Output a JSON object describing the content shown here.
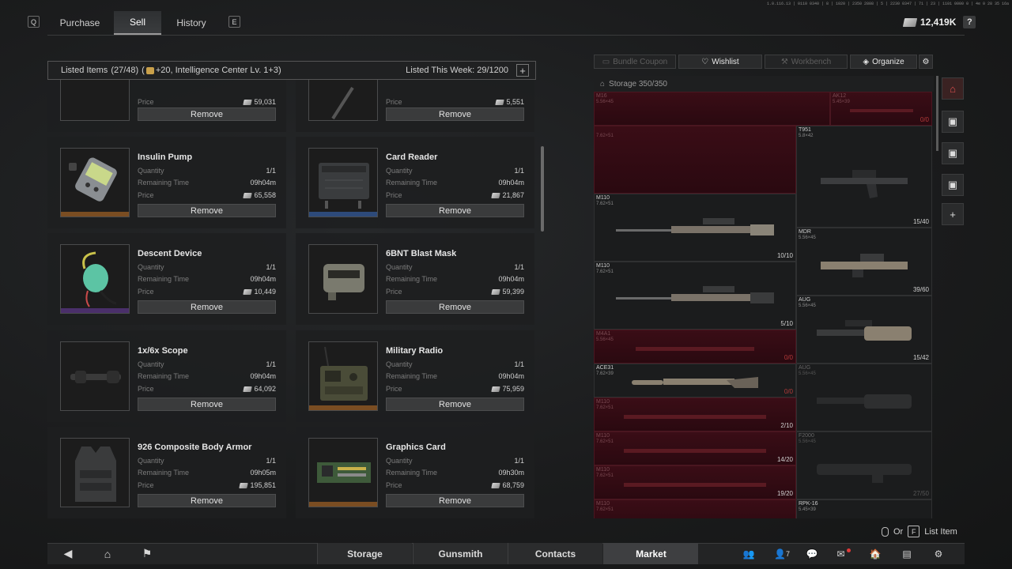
{
  "version_text": "1.0.116.13 | 0110 0340 | 8 | 1020 | 2350 2808 | 5 | 2230 0347 | 71 | 23 | 1101 0000 0 | 4e 0 28 35 16a",
  "top_nav": {
    "left_key": "Q",
    "tabs": [
      {
        "label": "Purchase"
      },
      {
        "label": "Sell",
        "active": true
      },
      {
        "label": "History"
      }
    ],
    "right_key": "E"
  },
  "currency": {
    "amount": "12,419K",
    "help": "?"
  },
  "listed": {
    "label": "Listed Items",
    "count": "(27/48)",
    "bonus": "+20, Intelligence Center Lv. 1+3)",
    "bonus_prefix": "(",
    "week": "Listed This Week: 29/1200",
    "add": "+"
  },
  "labels": {
    "quantity": "Quantity",
    "remaining": "Remaining Time",
    "price": "Price",
    "remove": "Remove"
  },
  "items": [
    {
      "name": "",
      "quantity": "",
      "time": "",
      "price": "59,031",
      "rarity": "#4a4b4c"
    },
    {
      "name": "",
      "quantity": "",
      "time": "",
      "price": "5,551",
      "rarity": "#4a4b4c"
    },
    {
      "name": "Insulin Pump",
      "quantity": "1/1",
      "time": "09h04m",
      "price": "65,558",
      "rarity": "#7a4d22"
    },
    {
      "name": "Card Reader",
      "quantity": "1/1",
      "time": "09h04m",
      "price": "21,867",
      "rarity": "#2d4a7a"
    },
    {
      "name": "Descent Device",
      "quantity": "1/1",
      "time": "09h04m",
      "price": "10,449",
      "rarity": "#4a2f6a"
    },
    {
      "name": "6BNT Blast Mask",
      "quantity": "1/1",
      "time": "09h04m",
      "price": "59,399",
      "rarity": "#4a4b4c"
    },
    {
      "name": "1x/6x Scope",
      "quantity": "1/1",
      "time": "09h04m",
      "price": "64,092",
      "rarity": "#4a4b4c"
    },
    {
      "name": "Military Radio",
      "quantity": "1/1",
      "time": "09h04m",
      "price": "75,959",
      "rarity": "#7a4d22"
    },
    {
      "name": "926 Composite Body Armor",
      "quantity": "1/1",
      "time": "09h05m",
      "price": "195,851",
      "rarity": "#4a4b4c"
    },
    {
      "name": "Graphics Card",
      "quantity": "1/1",
      "time": "09h30m",
      "price": "68,759",
      "rarity": "#7a4d22"
    }
  ],
  "right_tabs": [
    {
      "label": "Bundle Coupon",
      "icon": "coupon-icon"
    },
    {
      "label": "Wishlist",
      "icon": "heart-icon"
    },
    {
      "label": "Workbench",
      "icon": "wrench-icon"
    },
    {
      "label": "Organize",
      "icon": "layers-icon"
    }
  ],
  "storage": {
    "label": "Storage 350/350"
  },
  "guns": [
    {
      "name": "M16",
      "cal": "5.56×45",
      "count": "",
      "red": true
    },
    {
      "name": "AK12",
      "cal": "5.45×39",
      "count": "0/0",
      "red": true
    },
    {
      "name": "",
      "cal": "7.62×51",
      "count": "",
      "red": true
    },
    {
      "name": "T951",
      "cal": "5.8×42",
      "count": "",
      "red": false
    },
    {
      "name": "M110",
      "cal": "7.62×51",
      "count": "10/10",
      "red": false
    },
    {
      "name": "",
      "cal": "",
      "count": "15/40",
      "red": false
    },
    {
      "name": "MDR",
      "cal": "5.56×45",
      "count": "39/60",
      "red": false
    },
    {
      "name": "M110",
      "cal": "7.62×51",
      "count": "5/10",
      "red": false
    },
    {
      "name": "AUG",
      "cal": "5.56×45",
      "count": "15/42",
      "red": false
    },
    {
      "name": "M4A1",
      "cal": "5.56×45",
      "count": "0/0",
      "red": true
    },
    {
      "name": "ACE31",
      "cal": "7.62×39",
      "count": "0/0",
      "red": false
    },
    {
      "name": "AUG",
      "cal": "5.56×45",
      "count": "",
      "red": false
    },
    {
      "name": "M110",
      "cal": "7.62×51",
      "count": "2/10",
      "red": true
    },
    {
      "name": "M110",
      "cal": "7.62×51",
      "count": "14/20",
      "red": true
    },
    {
      "name": "F2000",
      "cal": "5.56×45",
      "count": "27/50",
      "red": false
    },
    {
      "name": "M110",
      "cal": "7.62×51",
      "count": "19/20",
      "red": true
    },
    {
      "name": "M110",
      "cal": "7.62×51",
      "count": "",
      "red": true
    },
    {
      "name": "RPK-16",
      "cal": "5.45×39",
      "count": "",
      "red": false
    }
  ],
  "hint": {
    "or": "Or",
    "key": "F",
    "label": "List Item"
  },
  "bottom_tabs": [
    {
      "label": "Storage"
    },
    {
      "label": "Gunsmith"
    },
    {
      "label": "Contacts"
    },
    {
      "label": "Market",
      "active": true
    }
  ],
  "bottom_badge": "7"
}
